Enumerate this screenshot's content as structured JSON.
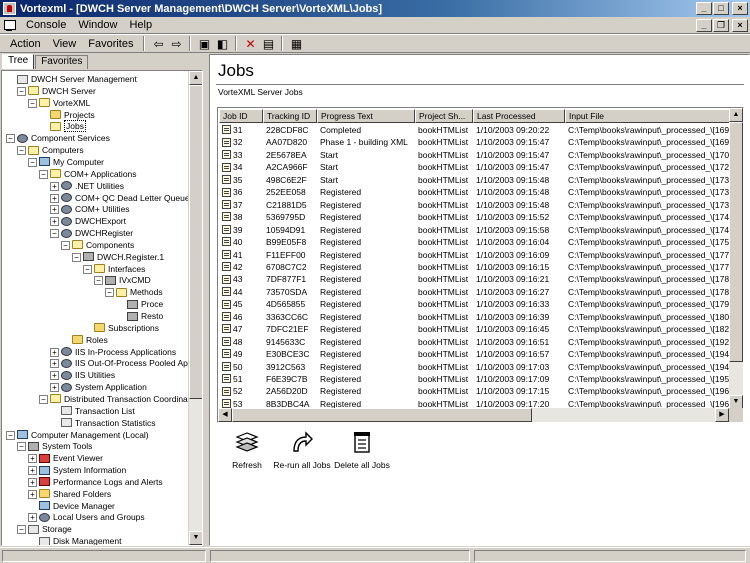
{
  "window": {
    "title": "Vortexml - [DWCH Server Management\\DWCH Server\\VorteXML\\Jobs]"
  },
  "menu": [
    "Console",
    "Window",
    "Help"
  ],
  "toolbar": {
    "action": "Action",
    "view": "View",
    "favorites": "Favorites"
  },
  "tabs": [
    "Tree",
    "Favorites"
  ],
  "tree": [
    {
      "label": "DWCH Server Management",
      "depth": 0,
      "icon": "pkg",
      "expander": ""
    },
    {
      "label": "DWCH Server",
      "depth": 1,
      "icon": "folder-open",
      "expander": "-"
    },
    {
      "label": "VorteXML",
      "depth": 2,
      "icon": "folder-open",
      "expander": "-"
    },
    {
      "label": "Projects",
      "depth": 3,
      "icon": "folder",
      "expander": ""
    },
    {
      "label": "Jobs",
      "depth": 3,
      "icon": "folder-open",
      "expander": "",
      "selected": true
    },
    {
      "label": "Component Services",
      "depth": 0,
      "icon": "gear",
      "expander": "-"
    },
    {
      "label": "Computers",
      "depth": 1,
      "icon": "folder-open",
      "expander": "-"
    },
    {
      "label": "My Computer",
      "depth": 2,
      "icon": "pc",
      "expander": "-"
    },
    {
      "label": "COM+ Applications",
      "depth": 3,
      "icon": "folder-open",
      "expander": "-"
    },
    {
      "label": ".NET Utilities",
      "depth": 4,
      "icon": "gear",
      "expander": "+"
    },
    {
      "label": "COM+ QC Dead Letter Queue",
      "depth": 4,
      "icon": "gear",
      "expander": "+"
    },
    {
      "label": "COM+ Utilities",
      "depth": 4,
      "icon": "gear",
      "expander": "+"
    },
    {
      "label": "DWCHExport",
      "depth": 4,
      "icon": "gear",
      "expander": "+"
    },
    {
      "label": "DWCHRegister",
      "depth": 4,
      "icon": "gear",
      "expander": "-"
    },
    {
      "label": "Components",
      "depth": 5,
      "icon": "folder-open",
      "expander": "-"
    },
    {
      "label": "DWCH.Register.1",
      "depth": 6,
      "icon": "comp",
      "expander": "-"
    },
    {
      "label": "Interfaces",
      "depth": 7,
      "icon": "folder-open",
      "expander": "-"
    },
    {
      "label": "IVxCMD",
      "depth": 8,
      "icon": "comp",
      "expander": "-"
    },
    {
      "label": "Methods",
      "depth": 9,
      "icon": "folder-open",
      "expander": "-"
    },
    {
      "label": "Proce",
      "depth": 10,
      "icon": "comp",
      "expander": ""
    },
    {
      "label": "Resto",
      "depth": 10,
      "icon": "comp",
      "expander": ""
    },
    {
      "label": "Subscriptions",
      "depth": 7,
      "icon": "folder",
      "expander": ""
    },
    {
      "label": "Roles",
      "depth": 5,
      "icon": "folder",
      "expander": ""
    },
    {
      "label": "IIS In-Process Applications",
      "depth": 4,
      "icon": "gear",
      "expander": "+"
    },
    {
      "label": "IIS Out-Of-Process Pooled Ap",
      "depth": 4,
      "icon": "gear",
      "expander": "+"
    },
    {
      "label": "IIS Utilities",
      "depth": 4,
      "icon": "gear",
      "expander": "+"
    },
    {
      "label": "System Application",
      "depth": 4,
      "icon": "gear",
      "expander": "+"
    },
    {
      "label": "Distributed Transaction Coordinat",
      "depth": 3,
      "icon": "folder-open",
      "expander": "-"
    },
    {
      "label": "Transaction List",
      "depth": 4,
      "icon": "pkg",
      "expander": ""
    },
    {
      "label": "Transaction Statistics",
      "depth": 4,
      "icon": "pkg",
      "expander": ""
    },
    {
      "label": "Computer Management (Local)",
      "depth": 0,
      "icon": "pc",
      "expander": "-"
    },
    {
      "label": "System Tools",
      "depth": 1,
      "icon": "comp",
      "expander": "-"
    },
    {
      "label": "Event Viewer",
      "depth": 2,
      "icon": "book",
      "expander": "+"
    },
    {
      "label": "System Information",
      "depth": 2,
      "icon": "pc",
      "expander": "+"
    },
    {
      "label": "Performance Logs and Alerts",
      "depth": 2,
      "icon": "book",
      "expander": "+"
    },
    {
      "label": "Shared Folders",
      "depth": 2,
      "icon": "folder",
      "expander": "+"
    },
    {
      "label": "Device Manager",
      "depth": 2,
      "icon": "pc",
      "expander": ""
    },
    {
      "label": "Local Users and Groups",
      "depth": 2,
      "icon": "gear",
      "expander": "+"
    },
    {
      "label": "Storage",
      "depth": 1,
      "icon": "pkg",
      "expander": "-"
    },
    {
      "label": "Disk Management",
      "depth": 2,
      "icon": "pkg",
      "expander": ""
    }
  ],
  "main": {
    "title": "Jobs",
    "subtitle": "VorteXML Server Jobs",
    "columns": [
      "Job ID",
      "Tracking ID",
      "Progress Text",
      "Project Sh...",
      "Last Processed",
      "Input File"
    ],
    "rows": [
      [
        "31",
        "228CDF8C",
        "Completed",
        "bookHTMList",
        "1/10/2003 09:20:22",
        "C:\\Temp\\books\\rawinput\\_processed_\\[1692..."
      ],
      [
        "32",
        "AA07D820",
        "Phase 1 - building XML",
        "bookHTMList",
        "1/10/2003 09:15:47",
        "C:\\Temp\\books\\rawinput\\_processed_\\[1698..."
      ],
      [
        "33",
        "2E5678EA",
        "Start",
        "bookHTMList",
        "1/10/2003 09:15:47",
        "C:\\Temp\\books\\rawinput\\_processed_\\[1704..."
      ],
      [
        "34",
        "A2CA966F",
        "Start",
        "bookHTMList",
        "1/10/2003 09:15:47",
        "C:\\Temp\\books\\rawinput\\_processed_\\[1724..."
      ],
      [
        "35",
        "498C6E2F",
        "Start",
        "bookHTMList",
        "1/10/2003 09:15:48",
        "C:\\Temp\\books\\rawinput\\_processed_\\[1730..."
      ],
      [
        "36",
        "252EE058",
        "Registered",
        "bookHTMList",
        "1/10/2003 09:15:48",
        "C:\\Temp\\books\\rawinput\\_processed_\\[1732..."
      ],
      [
        "37",
        "C21881D5",
        "Registered",
        "bookHTMList",
        "1/10/2003 09:15:48",
        "C:\\Temp\\books\\rawinput\\_processed_\\[1735..."
      ],
      [
        "38",
        "5369795D",
        "Registered",
        "bookHTMList",
        "1/10/2003 09:15:52",
        "C:\\Temp\\books\\rawinput\\_processed_\\[1740..."
      ],
      [
        "39",
        "10594D91",
        "Registered",
        "bookHTMList",
        "1/10/2003 09:15:58",
        "C:\\Temp\\books\\rawinput\\_processed_\\[1744..."
      ],
      [
        "40",
        "B99E05F8",
        "Registered",
        "bookHTMList",
        "1/10/2003 09:16:04",
        "C:\\Temp\\books\\rawinput\\_processed_\\[1758..."
      ],
      [
        "41",
        "F11EFF00",
        "Registered",
        "bookHTMList",
        "1/10/2003 09:16:09",
        "C:\\Temp\\books\\rawinput\\_processed_\\[177.h..."
      ],
      [
        "42",
        "6708C7C2",
        "Registered",
        "bookHTMList",
        "1/10/2003 09:16:15",
        "C:\\Temp\\books\\rawinput\\_processed_\\[1777..."
      ],
      [
        "43",
        "7DF877F1",
        "Registered",
        "bookHTMList",
        "1/10/2003 09:16:21",
        "C:\\Temp\\books\\rawinput\\_processed_\\[1781..."
      ],
      [
        "44",
        "73570SDA",
        "Registered",
        "bookHTMList",
        "1/10/2003 09:16:27",
        "C:\\Temp\\books\\rawinput\\_processed_\\[1785..."
      ],
      [
        "45",
        "4D565855",
        "Registered",
        "bookHTMList",
        "1/10/2003 09:16:33",
        "C:\\Temp\\books\\rawinput\\_processed_\\[1792..."
      ],
      [
        "46",
        "3363CC6C",
        "Registered",
        "bookHTMList",
        "1/10/2003 09:16:39",
        "C:\\Temp\\books\\rawinput\\_processed_\\[1802..."
      ],
      [
        "47",
        "7DFC21EF",
        "Registered",
        "bookHTMList",
        "1/10/2003 09:16:45",
        "C:\\Temp\\books\\rawinput\\_processed_\\[1821..."
      ],
      [
        "48",
        "9145633C",
        "Registered",
        "bookHTMList",
        "1/10/2003 09:16:51",
        "C:\\Temp\\books\\rawinput\\_processed_\\[1928..."
      ],
      [
        "49",
        "E30BCE3C",
        "Registered",
        "bookHTMList",
        "1/10/2003 09:16:57",
        "C:\\Temp\\books\\rawinput\\_processed_\\[1940..."
      ],
      [
        "50",
        "3912C563",
        "Registered",
        "bookHTMList",
        "1/10/2003 09:17:03",
        "C:\\Temp\\books\\rawinput\\_processed_\\[1946..."
      ],
      [
        "51",
        "F6E39C7B",
        "Registered",
        "bookHTMList",
        "1/10/2003 09:17:09",
        "C:\\Temp\\books\\rawinput\\_processed_\\[1954..."
      ],
      [
        "52",
        "2A56D20D",
        "Registered",
        "bookHTMList",
        "1/10/2003 09:17:15",
        "C:\\Temp\\books\\rawinput\\_processed_\\[1964..."
      ],
      [
        "53",
        "8B3DBC4A",
        "Registered",
        "bookHTMList",
        "1/10/2003 09:17:20",
        "C:\\Temp\\books\\rawinput\\_processed_\\[1968..."
      ]
    ],
    "actions": [
      {
        "label": "Refresh",
        "icon": "refresh-icon"
      },
      {
        "label": "Re-run all Jobs",
        "icon": "rerun-arrow-icon"
      },
      {
        "label": "Delete all Jobs",
        "icon": "delete-bin-icon"
      }
    ]
  }
}
